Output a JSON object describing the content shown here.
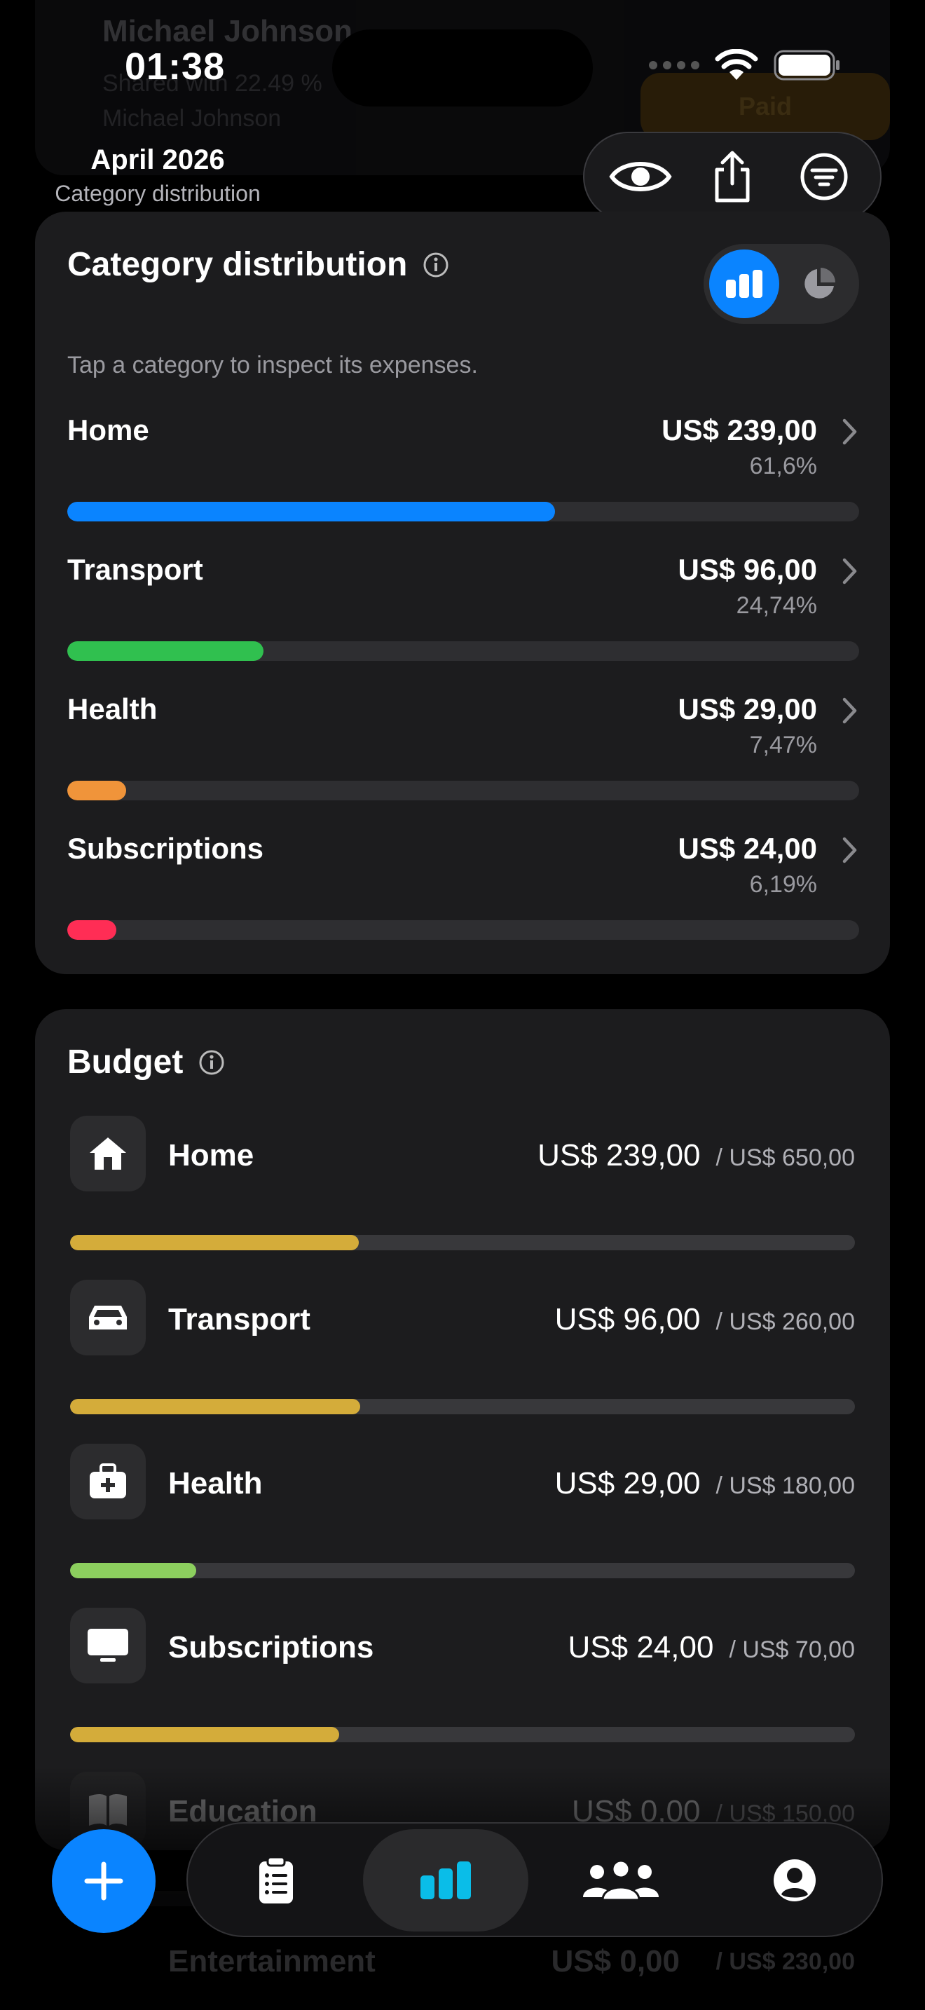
{
  "background": {
    "name": "Michael Johnson",
    "line1": "Shared with 22.49 %",
    "line2": "Michael Johnson",
    "button": "Paid"
  },
  "status_bar": {
    "time": "01:38"
  },
  "header": {
    "title": "April 2026",
    "subtitle": "Category distribution",
    "toolbar": [
      {
        "icon": "eye-icon"
      },
      {
        "icon": "share-icon"
      },
      {
        "icon": "filter-icon"
      }
    ]
  },
  "category_distribution": {
    "title": "Category distribution",
    "hint": "Tap a category to inspect its expenses.",
    "view_toggle": {
      "selected": "bar-chart",
      "options": [
        "bar-chart-icon",
        "pie-chart-icon"
      ]
    },
    "items": [
      {
        "name": "Home",
        "amount": "US$ 239,00",
        "percent": "61,6%",
        "share": 0.616,
        "color": "#0a84ff"
      },
      {
        "name": "Transport",
        "amount": "US$ 96,00",
        "percent": "24,74%",
        "share": 0.2474,
        "color": "#30c04f"
      },
      {
        "name": "Health",
        "amount": "US$ 29,00",
        "percent": "7,47%",
        "share": 0.0747,
        "color": "#f0943a"
      },
      {
        "name": "Subscriptions",
        "amount": "US$ 24,00",
        "percent": "6,19%",
        "share": 0.0619,
        "color": "#ff2d55"
      }
    ]
  },
  "budget": {
    "title": "Budget",
    "items": [
      {
        "name": "Home",
        "icon": "home-icon",
        "amount": "US$ 239,00",
        "limit": "/ US$ 650,00",
        "progress": 0.3677,
        "color": "#d4ac3a"
      },
      {
        "name": "Transport",
        "icon": "car-icon",
        "amount": "US$ 96,00",
        "limit": "/ US$ 260,00",
        "progress": 0.3692,
        "color": "#d4ac3a"
      },
      {
        "name": "Health",
        "icon": "medical-bag-icon",
        "amount": "US$ 29,00",
        "limit": "/ US$ 180,00",
        "progress": 0.1611,
        "color": "#8ccf5e"
      },
      {
        "name": "Subscriptions",
        "icon": "tv-icon",
        "amount": "US$ 24,00",
        "limit": "/ US$ 70,00",
        "progress": 0.3429,
        "color": "#d4ac3a"
      },
      {
        "name": "Education",
        "icon": "book-icon",
        "amount": "US$ 0,00",
        "limit": "/ US$ 150,00",
        "progress": 0,
        "color": "#d4ac3a"
      }
    ],
    "ghost": {
      "name": "Entertainment",
      "amount": "US$ 0,00",
      "limit": "/ US$ 230,00"
    }
  },
  "tabbar": {
    "fab": "plus-icon",
    "tabs": [
      {
        "icon": "clipboard-icon",
        "active": false
      },
      {
        "icon": "bar-chart-icon",
        "active": true
      },
      {
        "icon": "people-icon",
        "active": false
      },
      {
        "icon": "profile-icon",
        "active": false
      }
    ]
  }
}
